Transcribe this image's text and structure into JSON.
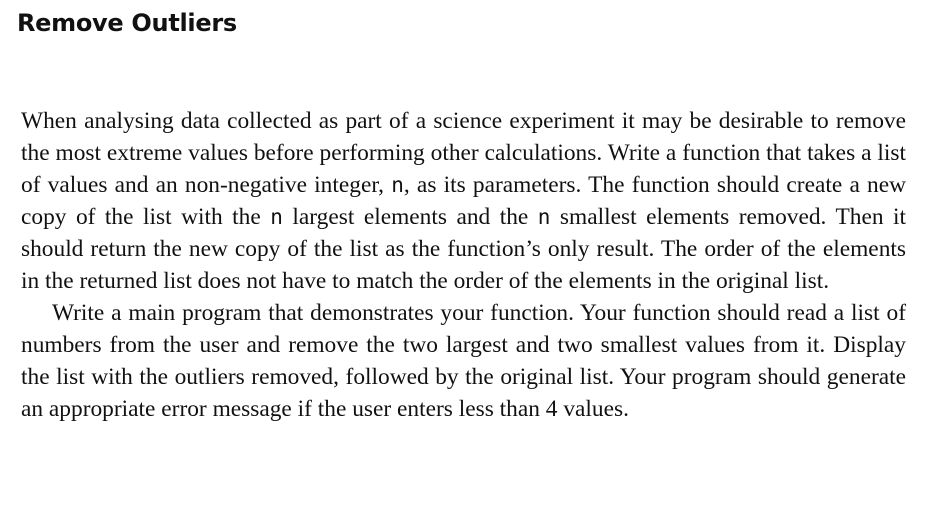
{
  "title": "Remove Outliers",
  "paragraph1": {
    "part1": "When analysing data collected as part of a science experiment it may be desirable to remove the most extreme values before performing other calculations. Write a function that takes a list of values and an non-negative integer, ",
    "code1": "n",
    "part2": ", as its parameters. The function should create a new copy of the list with the ",
    "code2": "n",
    "part3": " largest elements and the ",
    "code3": "n",
    "part4": " smallest elements removed. Then it should return the new copy of the list as the function’s only result. The order of the elements in the returned list does not have to match the order of the elements in the original list."
  },
  "paragraph2": "Write a main program that demonstrates your function. Your function should read a list of numbers from the user and remove the two largest and two smallest values from it. Display the list with the outliers removed, followed by the original list. Your program should generate an appropriate error message if the user enters less than 4 values."
}
